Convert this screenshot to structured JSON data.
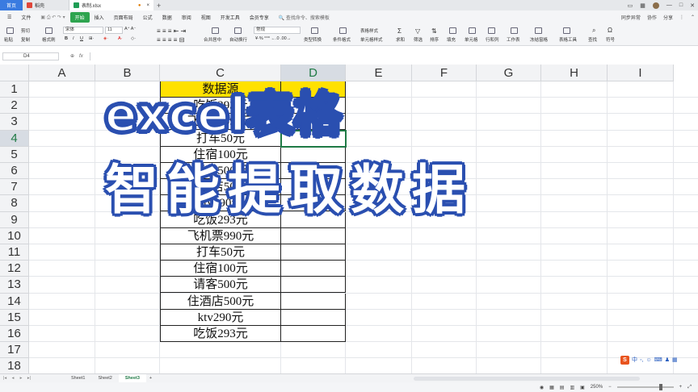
{
  "tabs": {
    "home": "首页",
    "t2": "稻壳",
    "t3": "表制.xlsx"
  },
  "menu": [
    "文件",
    "开始",
    "插入",
    "页面布局",
    "公式",
    "数据",
    "审阅",
    "视图",
    "开发工具",
    "会员专享"
  ],
  "menu_active": "开始",
  "menu_search": "查找命令、搜索模板",
  "menu_right": [
    "同步异常",
    "协作",
    "分享"
  ],
  "toolbar": {
    "paste": "粘贴",
    "cut": "剪切",
    "copy": "复制",
    "format_painter": "格式刷",
    "font": "宋体",
    "size": "11",
    "merge": "合并居中",
    "wrap": "自动换行",
    "numfmt": "常规",
    "type_convert": "类型转换",
    "cond_fmt": "条件格式",
    "table_style": "表格样式",
    "cell_style": "单元格样式",
    "sum": "求和",
    "filter": "筛选",
    "sort": "排序",
    "fill": "填充",
    "cell": "单元格",
    "rowcol": "行和列",
    "sheet": "工作表",
    "freeze": "冻结窗格",
    "table_tools": "表格工具",
    "find": "查找",
    "symbol": "符号"
  },
  "namebox": "D4",
  "fx": "fx",
  "columns": [
    "A",
    "B",
    "C",
    "D",
    "E",
    "F",
    "G",
    "H",
    "I"
  ],
  "rows": [
    "1",
    "2",
    "3",
    "4",
    "5",
    "6",
    "7",
    "8",
    "9",
    "10",
    "11",
    "12",
    "13",
    "14",
    "15",
    "16",
    "17",
    "18"
  ],
  "c_header": "数据源",
  "c_values": [
    "吃饭293元",
    "飞机票990元",
    "打车50元",
    "住宿100元",
    "请客500元",
    "住酒店500元",
    "ktv290元",
    "吃饭293元",
    "飞机票990元",
    "打车50元",
    "住宿100元",
    "请客500元",
    "住酒店500元",
    "ktv290元",
    "吃饭293元"
  ],
  "overlay": {
    "line1": "excel表格",
    "line2": "智能提取数据"
  },
  "sheets": [
    "Sheet1",
    "Sheet2",
    "Sheet3"
  ],
  "active_sheet": "Sheet3",
  "zoom": "250%",
  "ime": "中"
}
